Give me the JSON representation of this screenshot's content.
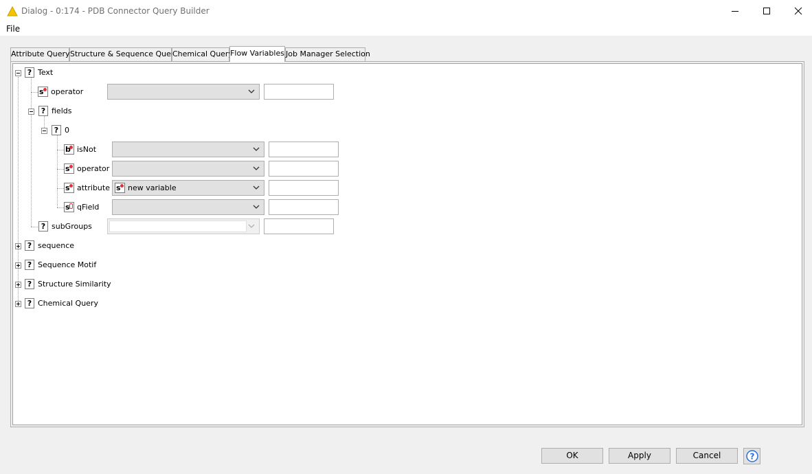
{
  "window": {
    "title": "Dialog - 0:174 - PDB Connector Query Builder",
    "app_icon": "knime-warning-triangle-icon",
    "accent": "#f5c400"
  },
  "menu": {
    "file": "File"
  },
  "tabs": [
    {
      "label": "Attribute Query",
      "active": false
    },
    {
      "label": "Structure & Sequence Query",
      "active": false
    },
    {
      "label": "Chemical Query",
      "active": false
    },
    {
      "label": "Flow Variables",
      "active": true
    },
    {
      "label": "Job Manager Selection",
      "active": false
    }
  ],
  "tree": {
    "text": {
      "label": "Text",
      "expanded": true,
      "type_icon": "?"
    },
    "text_operator": {
      "label": "operator",
      "type_icon": "s",
      "combo_value": "",
      "field_value": ""
    },
    "fields": {
      "label": "fields",
      "expanded": true,
      "type_icon": "?"
    },
    "zero": {
      "label": "0",
      "expanded": true,
      "type_icon": "?"
    },
    "isnot": {
      "label": "isNot",
      "type_icon": "b",
      "combo_value": "",
      "field_value": ""
    },
    "zero_operator": {
      "label": "operator",
      "type_icon": "s",
      "combo_value": "",
      "field_value": ""
    },
    "attribute": {
      "label": "attribute",
      "type_icon": "s",
      "combo_value": "new variable",
      "combo_icon": "s",
      "field_value": ""
    },
    "qfield": {
      "label": "qField",
      "type_icon": "s",
      "combo_value": "",
      "field_value": ""
    },
    "subgroups": {
      "label": "subGroups",
      "type_icon": "?",
      "combo_value": "",
      "field_value": "",
      "disabled": true
    },
    "sequence": {
      "label": "sequence",
      "expanded": false,
      "type_icon": "?"
    },
    "sequence_motif": {
      "label": "Sequence Motif",
      "expanded": false,
      "type_icon": "?"
    },
    "structure_similarity": {
      "label": "Structure Similarity",
      "expanded": false,
      "type_icon": "?"
    },
    "chemical_query": {
      "label": "Chemical Query",
      "expanded": false,
      "type_icon": "?"
    }
  },
  "buttons": {
    "ok": "OK",
    "apply": "Apply",
    "cancel": "Cancel",
    "help": "?"
  }
}
